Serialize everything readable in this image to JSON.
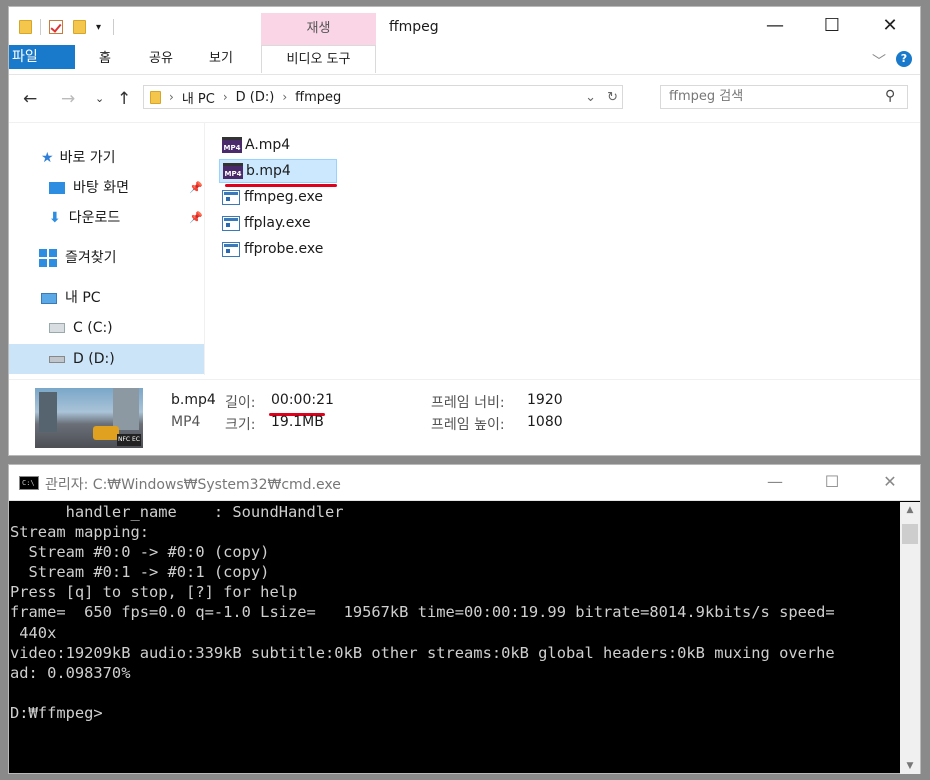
{
  "explorer": {
    "title": "ffmpeg",
    "context_tab": "재생",
    "ribbon_tabs": [
      "파일",
      "홈",
      "공유",
      "보기",
      "비디오 도구"
    ],
    "breadcrumb": [
      "내 PC",
      "D (D:)",
      "ffmpeg"
    ],
    "search_placeholder": "ffmpeg 검색",
    "sidebar": [
      {
        "label": "바로 가기",
        "icon": "star-icon"
      },
      {
        "label": "바탕 화면",
        "icon": "desktop-icon",
        "pinned": true
      },
      {
        "label": "다운로드",
        "icon": "download-icon",
        "pinned": true
      },
      {
        "label": "즐겨찾기",
        "icon": "windows-icon"
      },
      {
        "label": "내 PC",
        "icon": "pc-icon"
      },
      {
        "label": "C (C:)",
        "icon": "drive-icon"
      },
      {
        "label": "D (D:)",
        "icon": "drive-icon",
        "selected": true
      }
    ],
    "files": [
      {
        "name": "A.mp4",
        "type": "mp4"
      },
      {
        "name": "b.mp4",
        "type": "mp4",
        "selected": true
      },
      {
        "name": "ffmpeg.exe",
        "type": "exe"
      },
      {
        "name": "ffplay.exe",
        "type": "exe"
      },
      {
        "name": "ffprobe.exe",
        "type": "exe"
      }
    ],
    "details": {
      "name": "b.mp4",
      "type": "MP4",
      "length_label": "길이:",
      "length": "00:00:21",
      "size_label": "크기:",
      "size": "19.1MB",
      "width_label": "프레임 너비:",
      "width": "1920",
      "height_label": "프레임 높이:",
      "height": "1080",
      "thumb_badge": "NFC EC"
    },
    "annotation_color": "#e0001b"
  },
  "cmd": {
    "title": "관리자: C:₩Windows₩System32₩cmd.exe",
    "lines": [
      "      handler_name    : SoundHandler",
      "Stream mapping:",
      "  Stream #0:0 -> #0:0 (copy)",
      "  Stream #0:1 -> #0:1 (copy)",
      "Press [q] to stop, [?] for help",
      "frame=  650 fps=0.0 q=-1.0 Lsize=   19567kB time=00:00:19.99 bitrate=8014.9kbits/s speed=",
      " 440x",
      "video:19209kB audio:339kB subtitle:0kB other streams:0kB global headers:0kB muxing overhe",
      "ad: 0.098370%",
      "",
      "D:₩ffmpeg>"
    ]
  }
}
